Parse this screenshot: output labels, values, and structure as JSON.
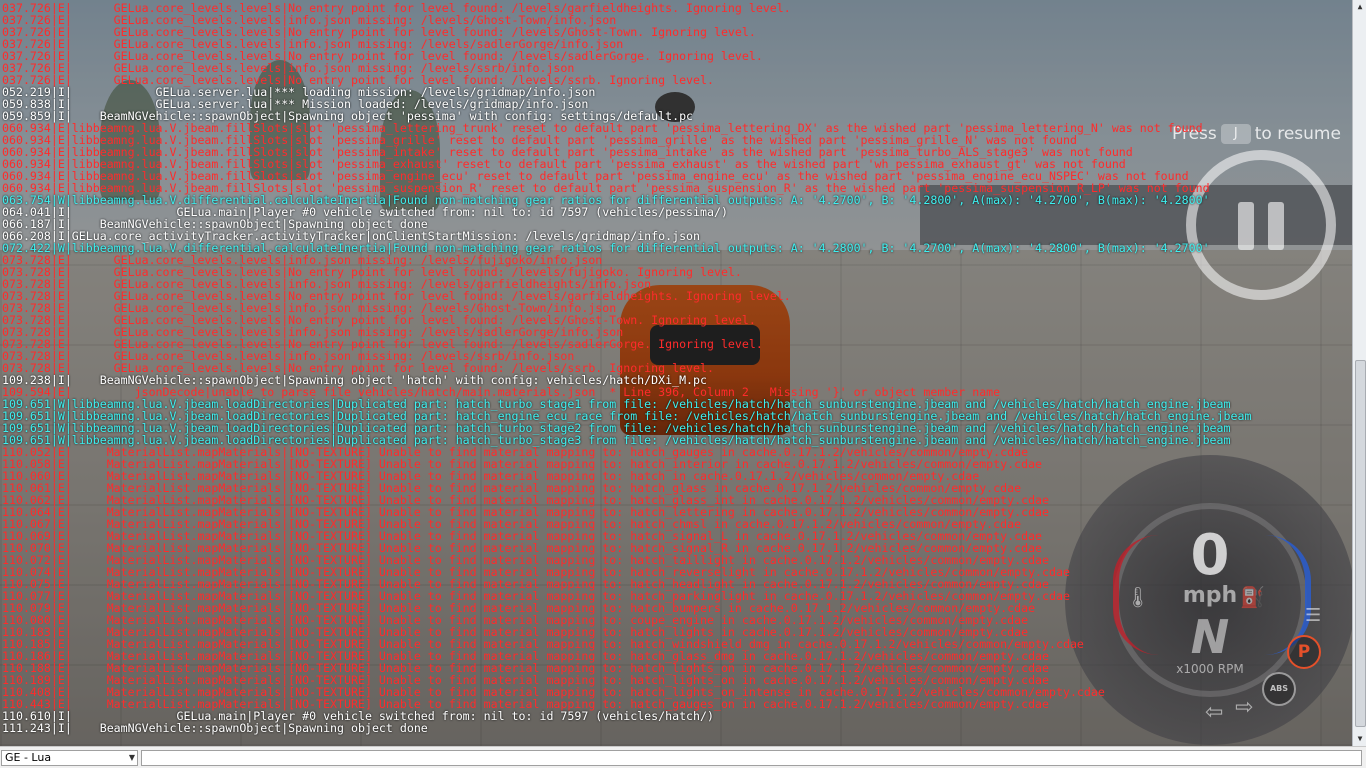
{
  "hud": {
    "resume_press": "Press",
    "resume_key": "J",
    "resume_text": "to resume",
    "speed": "0",
    "speed_unit": "mph",
    "gear": "N",
    "rpm_label": "x1000 RPM",
    "parking_badge": "P",
    "abs_badge": "ABS"
  },
  "console": {
    "selector_value": "GE - Lua",
    "input_value": "",
    "lines": [
      {
        "t": "err",
        "s": "037.726|E|      GELua.core_levels.levels|No entry point for level found: /levels/garfieldheights. Ignoring level."
      },
      {
        "t": "err",
        "s": "037.726|E|      GELua.core_levels.levels|info.json missing: /levels/Ghost-Town/info.json"
      },
      {
        "t": "err",
        "s": "037.726|E|      GELua.core_levels.levels|No entry point for level found: /levels/Ghost-Town. Ignoring level."
      },
      {
        "t": "err",
        "s": "037.726|E|      GELua.core_levels.levels|info.json missing: /levels/sadlerGorge/info.json"
      },
      {
        "t": "err",
        "s": "037.726|E|      GELua.core_levels.levels|No entry point for level found: /levels/sadlerGorge. Ignoring level."
      },
      {
        "t": "err",
        "s": "037.726|E|      GELua.core_levels.levels|info.json missing: /levels/ssrb/info.json"
      },
      {
        "t": "err",
        "s": "037.726|E|      GELua.core_levels.levels|No entry point for level found: /levels/ssrb. Ignoring level."
      },
      {
        "t": "info",
        "s": "052.219|I|            GELua.server.lua|*** loading mission: /levels/gridmap/info.json"
      },
      {
        "t": "info",
        "s": "059.838|I|            GELua.server.lua|*** Mission loaded: /levels/gridmap/info.json"
      },
      {
        "t": "info",
        "s": "059.859|I|    BeamNGVehicle::spawnObject|Spawning object 'pessima' with config: settings/default.pc"
      },
      {
        "t": "err",
        "s": "060.934|E|libbeamng.lua.V.jbeam.fillSlots|slot 'pessima_lettering_trunk' reset to default part 'pessima_lettering_DX' as the wished part 'pessima_lettering_N' was not found"
      },
      {
        "t": "err",
        "s": "060.934|E|libbeamng.lua.V.jbeam.fillSlots|slot 'pessima_grille' reset to default part 'pessima_grille' as the wished part 'pessima_grille_N' was not found"
      },
      {
        "t": "err",
        "s": "060.934|E|libbeamng.lua.V.jbeam.fillSlots|slot 'pessima_intake' reset to default part 'pessima_intake' as the wished part 'pessima_turbo_ALS_stage3' was not found"
      },
      {
        "t": "err",
        "s": "060.934|E|libbeamng.lua.V.jbeam.fillSlots|slot 'pessima_exhaust' reset to default part 'pessima_exhaust' as the wished part 'wh_pessima_exhaust_gt' was not found"
      },
      {
        "t": "err",
        "s": "060.934|E|libbeamng.lua.V.jbeam.fillSlots|slot 'pessima_engine_ecu' reset to default part 'pessima_engine_ecu' as the wished part 'pessima_engine_ecu_NSPEC' was not found"
      },
      {
        "t": "err",
        "s": "060.934|E|libbeamng.lua.V.jbeam.fillSlots|slot 'pessima_suspension_R' reset to default part 'pessima_suspension_R' as the wished part 'pessima_suspension_R_LP' was not found"
      },
      {
        "t": "warn",
        "s": "063.754|W|libbeamng.lua.V.differential.calculateInertia|Found non-matching gear ratios for differential outputs: A: '4.2700', B: '4.2800', A(max): '4.2700', B(max): '4.2800'"
      },
      {
        "t": "info",
        "s": "064.041|I|               GELua.main|Player #0 vehicle switched from: nil to: id 7597 (vehicles/pessima/)"
      },
      {
        "t": "info",
        "s": "066.187|I|    BeamNGVehicle::spawnObject|Spawning object done"
      },
      {
        "t": "info",
        "s": "066.208|I|GELua.core_activityTracker.activityTracker|onClientStartMission: /levels/gridmap/info.json"
      },
      {
        "t": "warn",
        "s": "072.422|W|libbeamng.lua.V.differential.calculateInertia|Found non-matching gear ratios for differential outputs: A: '4.2800', B: '4.2700', A(max): '4.2800', B(max): '4.2700'"
      },
      {
        "t": "err",
        "s": "073.728|E|      GELua.core_levels.levels|info.json missing: /levels/fujigoko/info.json"
      },
      {
        "t": "err",
        "s": "073.728|E|      GELua.core_levels.levels|No entry point for level found: /levels/fujigoko. Ignoring level."
      },
      {
        "t": "err",
        "s": "073.728|E|      GELua.core_levels.levels|info.json missing: /levels/garfieldheights/info.json"
      },
      {
        "t": "err",
        "s": "073.728|E|      GELua.core_levels.levels|No entry point for level found: /levels/garfieldheights. Ignoring level."
      },
      {
        "t": "err",
        "s": "073.728|E|      GELua.core_levels.levels|info.json missing: /levels/Ghost-Town/info.json"
      },
      {
        "t": "err",
        "s": "073.728|E|      GELua.core_levels.levels|No entry point for level found: /levels/Ghost-Town. Ignoring level."
      },
      {
        "t": "err",
        "s": "073.728|E|      GELua.core_levels.levels|info.json missing: /levels/sadlerGorge/info.json"
      },
      {
        "t": "err",
        "s": "073.728|E|      GELua.core_levels.levels|No entry point for level found: /levels/sadlerGorge. Ignoring level."
      },
      {
        "t": "err",
        "s": "073.728|E|      GELua.core_levels.levels|info.json missing: /levels/ssrb/info.json"
      },
      {
        "t": "err",
        "s": "073.728|E|      GELua.core_levels.levels|No entry point for level found: /levels/ssrb. Ignoring level."
      },
      {
        "t": "info",
        "s": "109.238|I|    BeamNGVehicle::spawnObject|Spawning object 'hatch' with config: vehicles/hatch/DXi_M.pc"
      },
      {
        "t": "err",
        "s": "109.594|E|         jsonDecode|unable to parse file vehicles/hatch/main.materials.json  * Line 396, Column 2   Missing '}' or object member name"
      },
      {
        "t": "warn",
        "s": "109.651|W|libbeamng.lua.V.jbeam.loadDirectories|Duplicated part: hatch_turbo_stage1 from file: /vehicles/hatch/hatch_sunburstengine.jbeam and /vehicles/hatch/hatch_engine.jbeam"
      },
      {
        "t": "warn",
        "s": "109.651|W|libbeamng.lua.V.jbeam.loadDirectories|Duplicated part: hatch_engine_ecu_race from file: /vehicles/hatch/hatch_sunburstengine.jbeam and /vehicles/hatch/hatch_engine.jbeam"
      },
      {
        "t": "warn",
        "s": "109.651|W|libbeamng.lua.V.jbeam.loadDirectories|Duplicated part: hatch_turbo_stage2 from file: /vehicles/hatch/hatch_sunburstengine.jbeam and /vehicles/hatch/hatch_engine.jbeam"
      },
      {
        "t": "warn",
        "s": "109.651|W|libbeamng.lua.V.jbeam.loadDirectories|Duplicated part: hatch_turbo_stage3 from file: /vehicles/hatch/hatch_sunburstengine.jbeam and /vehicles/hatch/hatch_engine.jbeam"
      },
      {
        "t": "err",
        "s": "110.052|E|     MaterialList.mapMaterials|[NO-TEXTURE] Unable to find material mapping to: hatch_gauges in cache.0.17.1.2/vehicles/common/empty.cdae"
      },
      {
        "t": "err",
        "s": "110.058|E|     MaterialList.mapMaterials|[NO-TEXTURE] Unable to find material mapping to: hatch_interior in cache.0.17.1.2/vehicles/common/empty.cdae"
      },
      {
        "t": "err",
        "s": "110.060|E|     MaterialList.mapMaterials|[NO-TEXTURE] Unable to find material mapping to: hatch in cache.0.17.1.2/vehicles/common/empty.cdae"
      },
      {
        "t": "err",
        "s": "110.061|E|     MaterialList.mapMaterials|[NO-TEXTURE] Unable to find material mapping to: hatch_glass in cache.0.17.1.2/vehicles/common/empty.cdae"
      },
      {
        "t": "err",
        "s": "110.062|E|     MaterialList.mapMaterials|[NO-TEXTURE] Unable to find material mapping to: hatch_glass_int in cache.0.17.1.2/vehicles/common/empty.cdae"
      },
      {
        "t": "err",
        "s": "110.064|E|     MaterialList.mapMaterials|[NO-TEXTURE] Unable to find material mapping to: hatch_lettering in cache.0.17.1.2/vehicles/common/empty.cdae"
      },
      {
        "t": "err",
        "s": "110.067|E|     MaterialList.mapMaterials|[NO-TEXTURE] Unable to find material mapping to: hatch_chmsl in cache.0.17.1.2/vehicles/common/empty.cdae"
      },
      {
        "t": "err",
        "s": "110.069|E|     MaterialList.mapMaterials|[NO-TEXTURE] Unable to find material mapping to: hatch_signal_L in cache.0.17.1.2/vehicles/common/empty.cdae"
      },
      {
        "t": "err",
        "s": "110.070|E|     MaterialList.mapMaterials|[NO-TEXTURE] Unable to find material mapping to: hatch_signal_R in cache.0.17.1.2/vehicles/common/empty.cdae"
      },
      {
        "t": "err",
        "s": "110.072|E|     MaterialList.mapMaterials|[NO-TEXTURE] Unable to find material mapping to: hatch_taillight in cache.0.17.1.2/vehicles/common/empty.cdae"
      },
      {
        "t": "err",
        "s": "110.074|E|     MaterialList.mapMaterials|[NO-TEXTURE] Unable to find material mapping to: hatch_reverselight in cache.0.17.1.2/vehicles/common/empty.cdae"
      },
      {
        "t": "err",
        "s": "110.075|E|     MaterialList.mapMaterials|[NO-TEXTURE] Unable to find material mapping to: hatch_headlight in cache.0.17.1.2/vehicles/common/empty.cdae"
      },
      {
        "t": "err",
        "s": "110.077|E|     MaterialList.mapMaterials|[NO-TEXTURE] Unable to find material mapping to: hatch_parkinglight in cache.0.17.1.2/vehicles/common/empty.cdae"
      },
      {
        "t": "err",
        "s": "110.079|E|     MaterialList.mapMaterials|[NO-TEXTURE] Unable to find material mapping to: hatch_bumpers in cache.0.17.1.2/vehicles/common/empty.cdae"
      },
      {
        "t": "err",
        "s": "110.080|E|     MaterialList.mapMaterials|[NO-TEXTURE] Unable to find material mapping to: coupe_engine in cache.0.17.1.2/vehicles/common/empty.cdae"
      },
      {
        "t": "err",
        "s": "110.183|E|     MaterialList.mapMaterials|[NO-TEXTURE] Unable to find material mapping to: hatch_lights in cache.0.17.1.2/vehicles/common/empty.cdae"
      },
      {
        "t": "err",
        "s": "110.185|E|     MaterialList.mapMaterials|[NO-TEXTURE] Unable to find material mapping to: hatch_windshield_dmg in cache.0.17.1.2/vehicles/common/empty.cdae"
      },
      {
        "t": "err",
        "s": "110.186|E|     MaterialList.mapMaterials|[NO-TEXTURE] Unable to find material mapping to: hatch_glass_dmg in cache.0.17.1.2/vehicles/common/empty.cdae"
      },
      {
        "t": "err",
        "s": "110.188|E|     MaterialList.mapMaterials|[NO-TEXTURE] Unable to find material mapping to: hatch_lights_on in cache.0.17.1.2/vehicles/common/empty.cdae"
      },
      {
        "t": "err",
        "s": "110.189|E|     MaterialList.mapMaterials|[NO-TEXTURE] Unable to find material mapping to: hatch_lights_on in cache.0.17.1.2/vehicles/common/empty.cdae"
      },
      {
        "t": "err",
        "s": "110.408|E|     MaterialList.mapMaterials|[NO-TEXTURE] Unable to find material mapping to: hatch_lights_on_intense in cache.0.17.1.2/vehicles/common/empty.cdae"
      },
      {
        "t": "err",
        "s": "110.443|E|     MaterialList.mapMaterials|[NO-TEXTURE] Unable to find material mapping to: hatch_gauges_on in cache.0.17.1.2/vehicles/common/empty.cdae"
      },
      {
        "t": "info",
        "s": "110.610|I|               GELua.main|Player #0 vehicle switched from: nil to: id 7597 (vehicles/hatch/)"
      },
      {
        "t": "info",
        "s": "111.243|I|    BeamNGVehicle::spawnObject|Spawning object done"
      }
    ]
  }
}
